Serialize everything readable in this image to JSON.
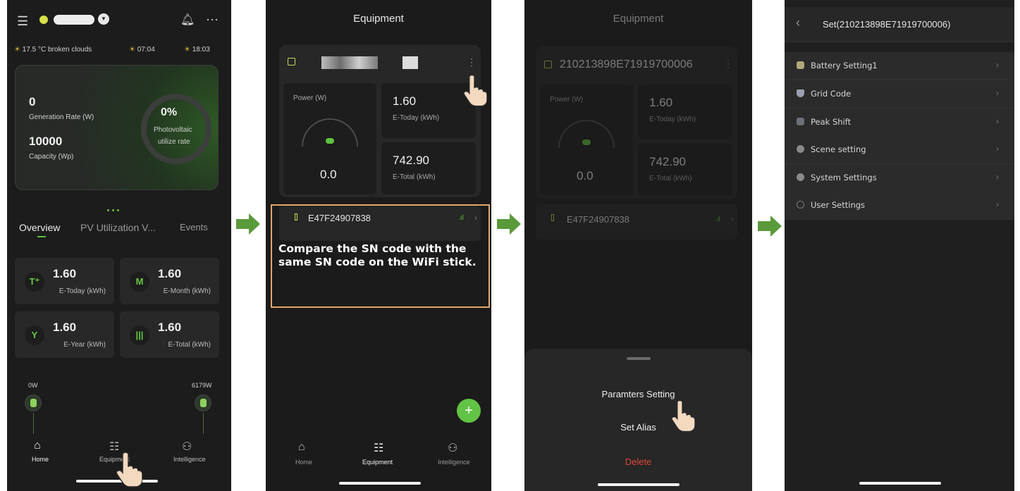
{
  "colors": {
    "accent": "#62c346",
    "arrow": "#5a9a3a",
    "highlight": "#e2a66b",
    "danger": "#e0453a"
  },
  "screen1": {
    "weather": {
      "temp": "17.5 °C broken clouds",
      "sunrise": "07:04",
      "sunset": "18:03"
    },
    "hero": {
      "generation_value": "0",
      "generation_label": "Generation Rate (W)",
      "capacity_value": "10000",
      "capacity_label": "Capacity (Wp)",
      "utilization_percent": "0%",
      "utilization_label_1": "Photovoltaic",
      "utilization_label_2": "utilize rate"
    },
    "tabs": [
      "Overview",
      "PV Utilization V...",
      "Events"
    ],
    "stats": [
      {
        "icon": "today-icon",
        "value": "1.60",
        "label": "E-Today (kWh)"
      },
      {
        "icon": "month-icon",
        "value": "1.60",
        "label": "E-Month (kWh)"
      },
      {
        "icon": "year-icon",
        "value": "1.60",
        "label": "E-Year (kWh)"
      },
      {
        "icon": "total-icon",
        "value": "1.60",
        "label": "E-Total (kWh)"
      }
    ],
    "flow": {
      "left_power": "0W",
      "right_power": "6179W"
    },
    "nav": [
      "Home",
      "Equipment",
      "Intelligence"
    ]
  },
  "screen2": {
    "title": "Equipment",
    "power_label": "Power (W)",
    "power_value": "0.0",
    "today_value": "1.60",
    "today_label": "E-Today (kWh)",
    "total_value": "742.90",
    "total_label": "E-Total (kWh)",
    "sn": "E47F24907838",
    "callout": "Compare the SN code with the same SN code on the WiFi stick.",
    "fab": "+",
    "nav": [
      "Home",
      "Equipment",
      "Intelligence"
    ]
  },
  "screen3": {
    "title": "Equipment",
    "device_sn": "210213898E71919700006",
    "power_label": "Power (W)",
    "power_value": "0.0",
    "today_value": "1.60",
    "today_label": "E-Today (kWh)",
    "total_value": "742.90",
    "total_label": "E-Total (kWh)",
    "sn": "E47F24907838",
    "sheet": [
      "Paramters Setting",
      "Set Alias",
      "Delete"
    ]
  },
  "screen4": {
    "title": "Set(210213898E71919700006)",
    "menu": [
      "Battery Setting1",
      "Grid Code",
      "Peak Shift",
      "Scene setting",
      "System Settings",
      "User Settings"
    ]
  }
}
